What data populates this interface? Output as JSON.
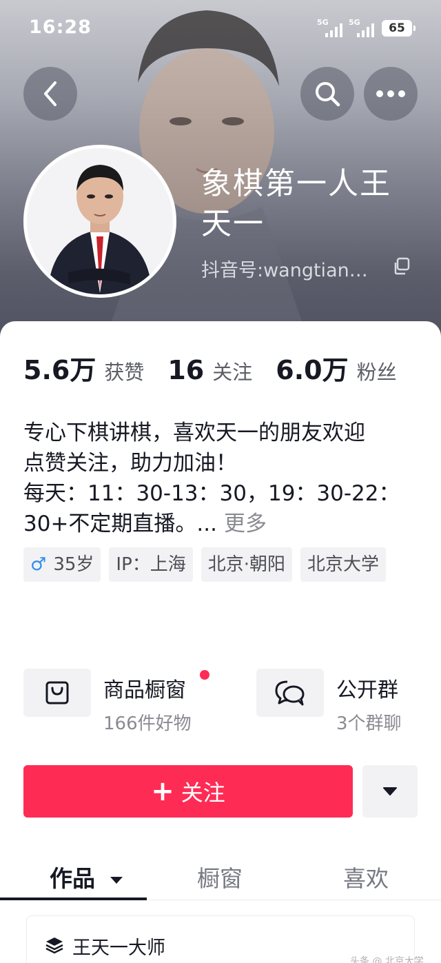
{
  "status_bar": {
    "time": "16:28",
    "network_1": "5G",
    "network_2": "5G",
    "battery": "65"
  },
  "profile": {
    "name": "象棋第一人王天一",
    "douyin_id": "抖音号:wangtian…",
    "avatar_icon": "avatar-photo"
  },
  "stats": [
    {
      "value": "5.6万",
      "label": "获赞"
    },
    {
      "value": "16",
      "label": "关注"
    },
    {
      "value": "6.0万",
      "label": "粉丝"
    }
  ],
  "bio": {
    "line1": "专心下棋讲棋，喜欢天一的朋友欢迎",
    "line2": "点赞关注，助力加油！",
    "line3": "每天：11：30-13：30，19：30-22：",
    "line4": "30+不定期直播。...",
    "more_label": "更多"
  },
  "tags": {
    "gender_icon": "♂",
    "age": "35岁",
    "ip": "IP：上海",
    "location": "北京·朝阳",
    "school": "北京大学"
  },
  "tiles": {
    "shop_title": "商品橱窗",
    "shop_sub": "166件好物",
    "group_title": "公开群",
    "group_sub": "3个群聊"
  },
  "actions": {
    "follow_plus": "+",
    "follow_label": "关注"
  },
  "tabs": [
    {
      "label": "作品"
    },
    {
      "label": "橱窗"
    },
    {
      "label": "喜欢"
    }
  ],
  "collection": {
    "label": "王天一大师"
  },
  "watermark": "头条 @ 北京大学",
  "colors": {
    "accent": "#fe2c55",
    "text_primary": "#161823",
    "text_secondary": "#8a8b91",
    "tag_bg": "#f2f2f4"
  }
}
